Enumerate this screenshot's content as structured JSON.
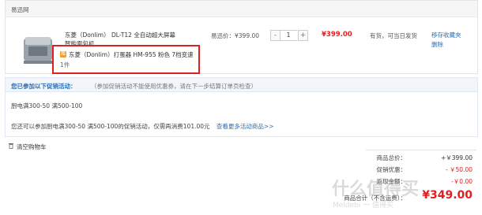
{
  "store": {
    "name": "易迅网"
  },
  "item": {
    "title": "东菱（Donlim） DL-T12 全自动超大屏幕智能面包机",
    "unit_price": "易迅价：¥399.00",
    "quantity": "1",
    "minus": "-",
    "plus": "+",
    "subtotal": "¥399.00",
    "stock": "有货，可当日发货",
    "actions": [
      "移存收藏夹",
      "删除"
    ]
  },
  "gift": {
    "icon": "赠",
    "text": "东菱（Donlim）打蛋器 HM-955 粉色 7档变速",
    "qty": "1件"
  },
  "promo": {
    "title": "您已参加以下促销活动：",
    "note": "（参加促销活动不能使用优惠券，请在下一步结算订单页检查）",
    "rule": "厨电满300-50 满500-100",
    "hint": "您还可以参加厨电满300-50 满500-100的促销活动，仅需再消费101.00元",
    "more_link": "查看更多活动商品>>"
  },
  "cart": {
    "clear_label": "清空购物车"
  },
  "summary": {
    "rows": [
      {
        "label": "商品总价：",
        "value": "+￥399.00"
      },
      {
        "label": "促销优惠：",
        "value": "- ￥50.00"
      },
      {
        "label": "返现金额：",
        "value": "-￥0.00"
      }
    ],
    "total_label": "商品合计（不含运费）：",
    "total_value": "¥349.00"
  },
  "watermark": {
    "main": "什么值得买",
    "sub": "Meldebi 一 值得买"
  },
  "colors": {
    "accent_red": "#e02020",
    "link_blue": "#2a6fb5",
    "highlight_border": "#e02020"
  }
}
